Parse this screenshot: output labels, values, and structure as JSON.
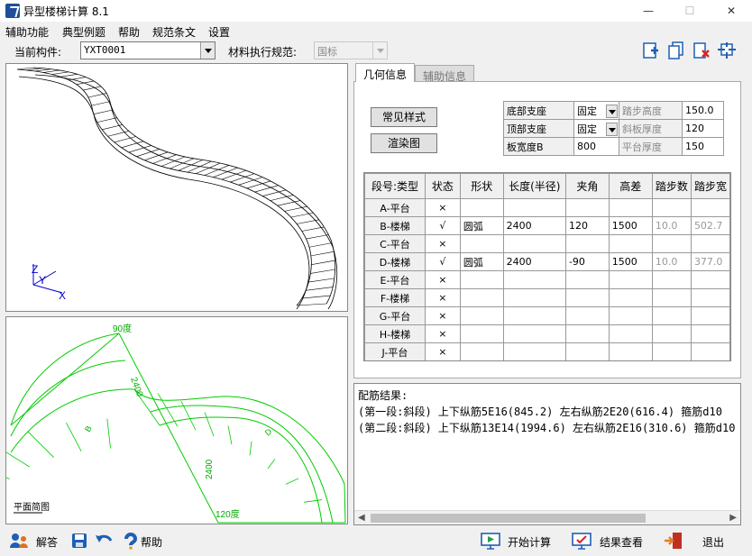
{
  "window": {
    "title": "异型楼梯计算 8.1",
    "controls": {
      "minimize": "—",
      "maximize": "☐",
      "close": "✕"
    }
  },
  "menu": [
    "辅助功能",
    "典型例题",
    "帮助",
    "规范条文",
    "设置"
  ],
  "component_row": {
    "current_label": "当前构件:",
    "current_value": "YXT0001",
    "material_label": "材料执行规范:",
    "material_value": "国标"
  },
  "toolbar_icons": [
    "add-file-icon",
    "copy-icon",
    "delete-icon",
    "export-icon"
  ],
  "view3d": {
    "axis_z": "Z",
    "axis_y": "Y",
    "axis_x": "X"
  },
  "plan_view": {
    "caption": "平面简图",
    "angle_top": "90度",
    "angle_bottom": "120度",
    "dim_a": "2400",
    "dim_b": "2400",
    "label_left": "B",
    "label_right": "D"
  },
  "tabs": [
    {
      "label": "几何信息",
      "active": true
    },
    {
      "label": "辅助信息",
      "active": false
    }
  ],
  "buttons": {
    "common_style": "常见样式",
    "render": "渲染图"
  },
  "props": {
    "bottom_support_label": "底部支座",
    "bottom_support_value": "固定",
    "step_height_label": "踏步高度",
    "step_height_value": "150.0",
    "top_support_label": "顶部支座",
    "top_support_value": "固定",
    "slab_thickness_label": "斜板厚度",
    "slab_thickness_value": "120",
    "width_label": "板宽度B",
    "width_value": "800",
    "platform_thickness_label": "平台厚度",
    "platform_thickness_value": "150"
  },
  "segment_table": {
    "headers": [
      "段号:类型",
      "状态",
      "形状",
      "长度(半径)",
      "夹角",
      "高差",
      "踏步数",
      "踏步宽"
    ],
    "rows": [
      [
        "A-平台",
        "×",
        "",
        "",
        "",
        "",
        "",
        ""
      ],
      [
        "B-楼梯",
        "√",
        "圆弧",
        "2400",
        "120",
        "1500",
        "10.0",
        "502.7"
      ],
      [
        "C-平台",
        "×",
        "",
        "",
        "",
        "",
        "",
        ""
      ],
      [
        "D-楼梯",
        "√",
        "圆弧",
        "2400",
        "-90",
        "1500",
        "10.0",
        "377.0"
      ],
      [
        "E-平台",
        "×",
        "",
        "",
        "",
        "",
        "",
        ""
      ],
      [
        "F-楼梯",
        "×",
        "",
        "",
        "",
        "",
        "",
        ""
      ],
      [
        "G-平台",
        "×",
        "",
        "",
        "",
        "",
        "",
        ""
      ],
      [
        "H-楼梯",
        "×",
        "",
        "",
        "",
        "",
        "",
        ""
      ],
      [
        "J-平台",
        "×",
        "",
        "",
        "",
        "",
        "",
        ""
      ]
    ]
  },
  "results": {
    "title": "配筋结果:",
    "lines": [
      "(第一段:斜段) 上下纵筋5E16(845.2) 左右纵筋2E20(616.4) 箍筋d10",
      "(第二段:斜段) 上下纵筋13E14(1994.6) 左右纵筋2E16(310.6) 箍筋d10"
    ]
  },
  "footer": {
    "answer": "解答",
    "help": "帮助",
    "start": "开始计算",
    "view_results": "结果查看",
    "exit": "退出"
  },
  "colors": {
    "plan_green": "#00cc00",
    "axis_blue": "#0000cc",
    "icon_blue": "#1f5fb4"
  }
}
